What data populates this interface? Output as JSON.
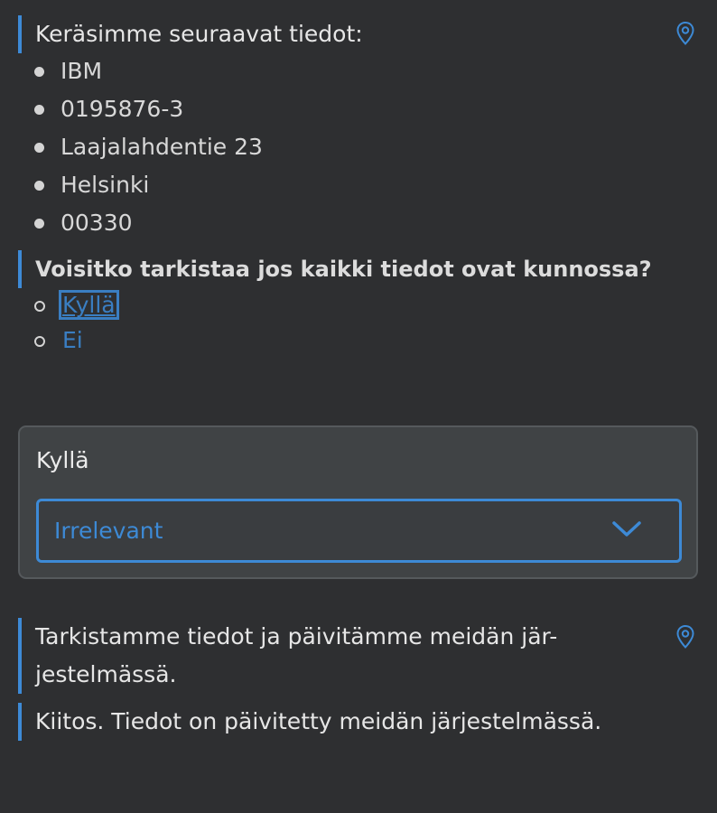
{
  "message1": {
    "intro": "Keräsimme seuraavat tiedot:",
    "items": [
      "IBM",
      "0195876-3",
      "Laajalahdentie 23",
      "Helsinki",
      "00330"
    ],
    "icon": "location-pin-icon"
  },
  "question": {
    "text": "Voisitko tarkistaa jos kaikki tiedot ovat kunnossa?",
    "options": [
      "Kyllä",
      "Ei"
    ]
  },
  "form": {
    "title": "Kyllä",
    "dropdown_value": "Irrelevant",
    "dropdown_icon": "chevron-down-icon"
  },
  "message2": {
    "line1": "Tarkistamme tiedot ja päivitämme meidän jär-",
    "line2": "jestelmässä.",
    "icon": "location-pin-icon"
  },
  "message3": {
    "text": "Kiitos. Tiedot on päivitetty meidän järjestelmässä."
  },
  "colors": {
    "background": "#2e2f31",
    "accent": "#3d8ad6",
    "link": "#3a7ec2",
    "card": "#404345"
  }
}
